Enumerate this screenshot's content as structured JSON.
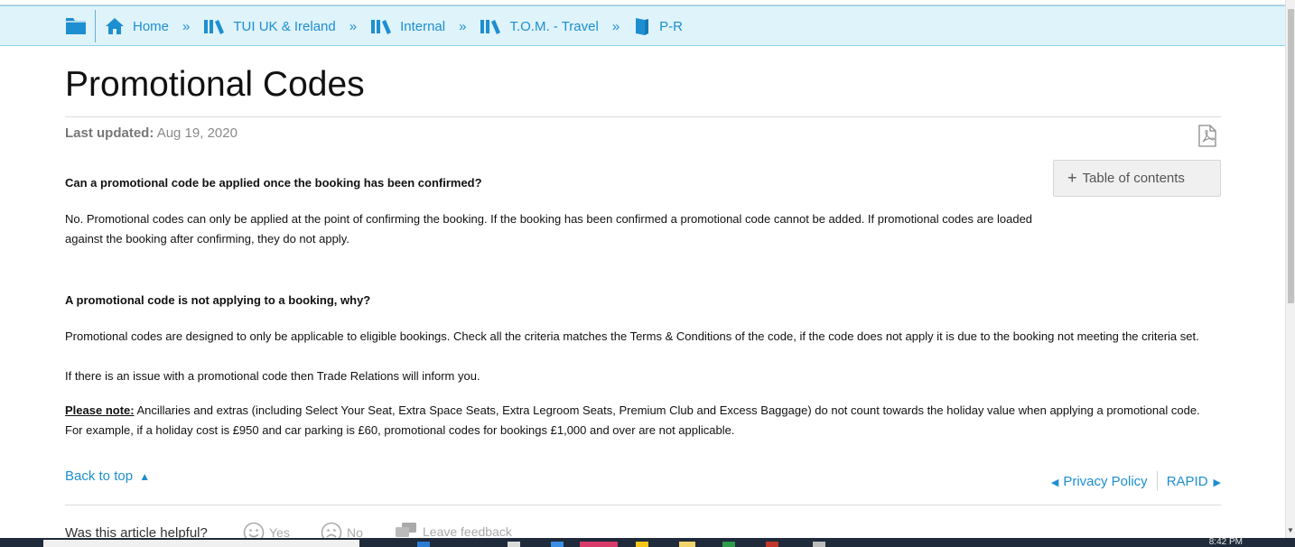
{
  "breadcrumb": {
    "items": [
      {
        "label": "Home",
        "icon": "home-icon"
      },
      {
        "label": "TUI UK & Ireland",
        "icon": "library-icon"
      },
      {
        "label": "Internal",
        "icon": "library-icon"
      },
      {
        "label": "T.O.M. - Travel",
        "icon": "library-icon"
      },
      {
        "label": "P-R",
        "icon": "book-icon"
      }
    ],
    "separator": "»",
    "folder_icon": "folder-icon"
  },
  "page": {
    "title": "Promotional Codes",
    "last_updated_label": "Last updated:",
    "last_updated_value": "Aug 19, 2020",
    "pdf_icon": "pdf-icon"
  },
  "toc": {
    "label": "Table of contents"
  },
  "content": {
    "q1": "Can a promotional code be applied once the booking has been confirmed?",
    "a1": "No. Promotional codes can only be applied at the point of confirming the booking. If the booking has been confirmed a promotional code cannot be added. If promotional codes are loaded against the booking after confirming, they do not apply.",
    "q2": "A promotional code is not applying to a booking, why?",
    "a2": "Promotional codes are designed to only be applicable to eligible bookings. Check all the criteria matches the Terms & Conditions of the code, if the code does not apply it is due to the booking not meeting the criteria set.",
    "a2b": "If there is an issue with a promotional code then Trade Relations will inform you.",
    "note_label": "Please note:",
    "note_text": " Ancillaries and extras (including Select Your Seat, Extra Space Seats, Extra Legroom Seats, Premium Club and Excess Baggage) do not count towards the holiday value when applying a promotional code. For example, if a holiday cost is £950 and car parking is £60, promotional codes for bookings £1,000 and over are not applicable."
  },
  "footer": {
    "back_to_top": "Back to top",
    "prev_link": "Privacy Policy",
    "next_link": "RAPID",
    "helpful_question": "Was this article helpful?",
    "yes_label": "Yes",
    "no_label": "No",
    "feedback_label": "Leave feedback"
  },
  "taskbar": {
    "clock": "8:42 PM"
  },
  "colors": {
    "link": "#1d8fd0",
    "breadcrumb_bg": "#dff3fb",
    "breadcrumb_border": "#8fd3ee"
  }
}
